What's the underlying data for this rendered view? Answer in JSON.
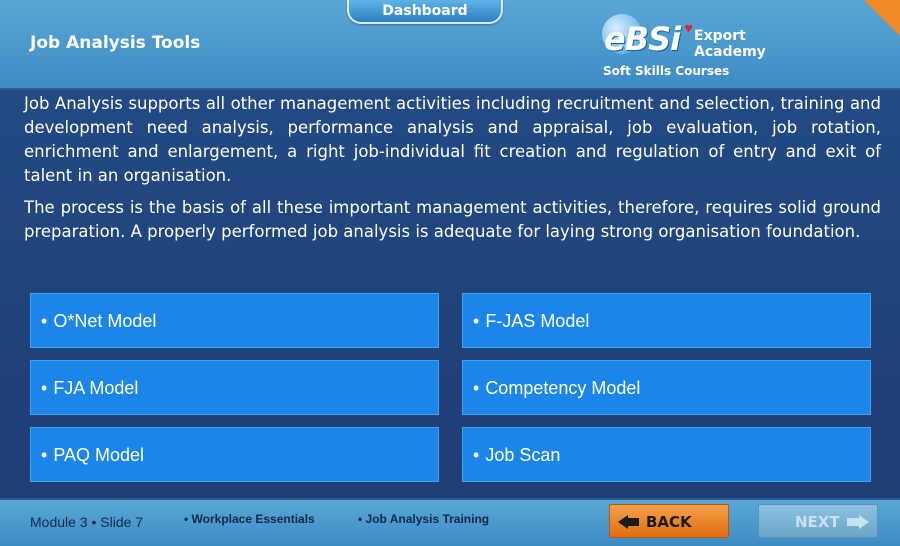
{
  "header": {
    "dashboard_label": "Dashboard",
    "title": "Job Analysis Tools",
    "logo": {
      "brand": "eBSi",
      "line1": "Export",
      "line2": "Academy",
      "tagline": "Soft Skills Courses"
    }
  },
  "content": {
    "paragraphs": [
      "Job Analysis supports all other management activities including recruitment and selection, training and development need analysis, performance analysis and appraisal, job evaluation, job rotation, enrichment and enlargement, a right job-individual fit creation and regulation of entry and exit of talent in an organisation.",
      "The process is the basis of all these important management activities, therefore, requires solid ground preparation. A properly performed job analysis is adequate for laying strong organisation foundation."
    ]
  },
  "models": [
    {
      "label": "O*Net Model"
    },
    {
      "label": "F-JAS Model"
    },
    {
      "label": "FJA Model"
    },
    {
      "label": "Competency Model"
    },
    {
      "label": "PAQ Model"
    },
    {
      "label": "Job Scan"
    }
  ],
  "footer": {
    "module": "Module 3 • Slide 7",
    "crumb1": "• Workplace Essentials",
    "crumb2": "• Job Analysis Training",
    "back_label": "BACK",
    "next_label": "NEXT"
  },
  "colors": {
    "accent_orange": "#f08a24",
    "box_blue": "#1c86e8",
    "background": "#1e3c72"
  }
}
